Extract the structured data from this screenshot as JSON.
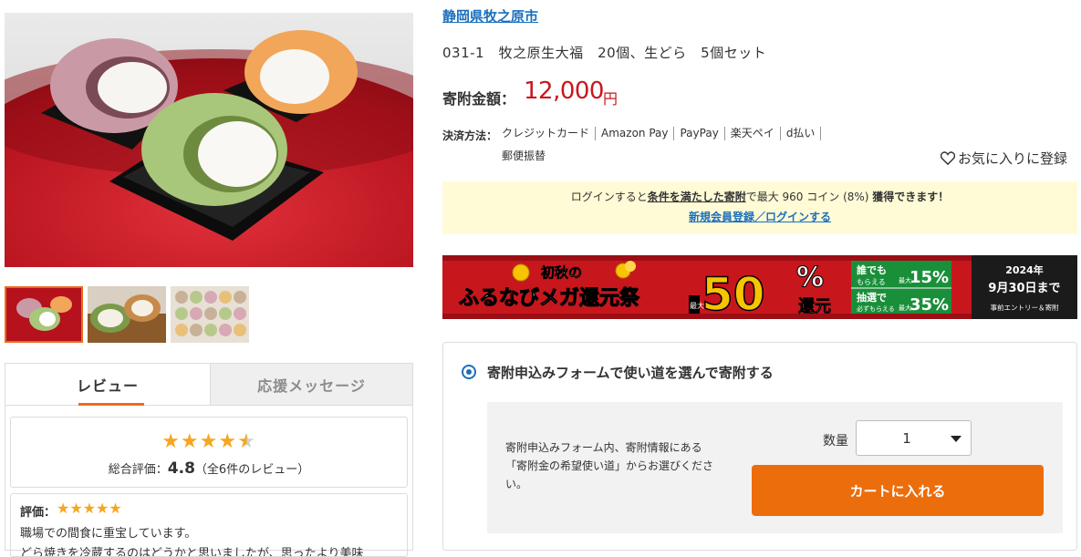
{
  "product": {
    "city": "静岡県牧之原市",
    "name": "031-1　牧之原生大福　20個、生どら　5個セット",
    "price_label": "寄附金額：",
    "price_value": "12,000",
    "price_unit": "円"
  },
  "payment": {
    "label": "決済方法：",
    "methods": [
      "クレジットカード",
      "Amazon Pay",
      "PayPay",
      "楽天ペイ",
      "d払い"
    ],
    "extra": "郵便振替"
  },
  "favorite": {
    "icon": "heart-icon",
    "label": "お気に入りに登録"
  },
  "login_notice": {
    "prefix": "ログインすると",
    "condition_link": "条件を満たした寄附",
    "suffix_plain": "で最大 960 コイン (8%) ",
    "suffix_bold": "獲得できます！",
    "register_link": "新規会員登録／ログインする"
  },
  "banner": {
    "season": "初秋の",
    "title": "ふるなびメガ還元祭",
    "max": "最大",
    "percent": "50",
    "percent_sign": "%",
    "return": "還元",
    "everyone_1": "誰でも",
    "everyone_2": "もらえる",
    "everyone_max": "最大",
    "everyone_pct": "15%",
    "lottery_1": "抽選で",
    "lottery_2": "必ずもらえる",
    "lottery_max": "最大",
    "lottery_pct": "35%",
    "year": "2024年",
    "date": "9月30日まで",
    "entry": "事前エントリー＆寄附",
    "bg_color": "#c8161d",
    "accent_color": "#f6c400"
  },
  "donation_form": {
    "option_label": "寄附申込みフォームで使い道を選んで寄附する",
    "instruction": "寄附申込みフォーム内、寄附情報にある「寄附金の希望使い道」からお選びください。",
    "qty_label": "数量",
    "qty_value": "1",
    "cart_button": "カートに入れる",
    "button_color": "#ec6d0c"
  },
  "tabs": [
    {
      "label": "レビュー",
      "active": true
    },
    {
      "label": "応援メッセージ",
      "active": false
    }
  ],
  "review_summary": {
    "stars": "★★★★",
    "half_star": "★",
    "label": "総合評価：",
    "score": "4.8",
    "count_text": "（全6件のレビュー）"
  },
  "review": {
    "rating_label": "評価：",
    "stars": "★★★★★",
    "line1": "職場での間食に重宝しています。",
    "line2": "どら焼きを冷蔵するのはどうかと思いましたが、思ったより美味"
  },
  "colors": {
    "accent": "#e86d1f",
    "link": "#1a6fbd",
    "price": "#c8161d",
    "star": "#f5a623"
  }
}
